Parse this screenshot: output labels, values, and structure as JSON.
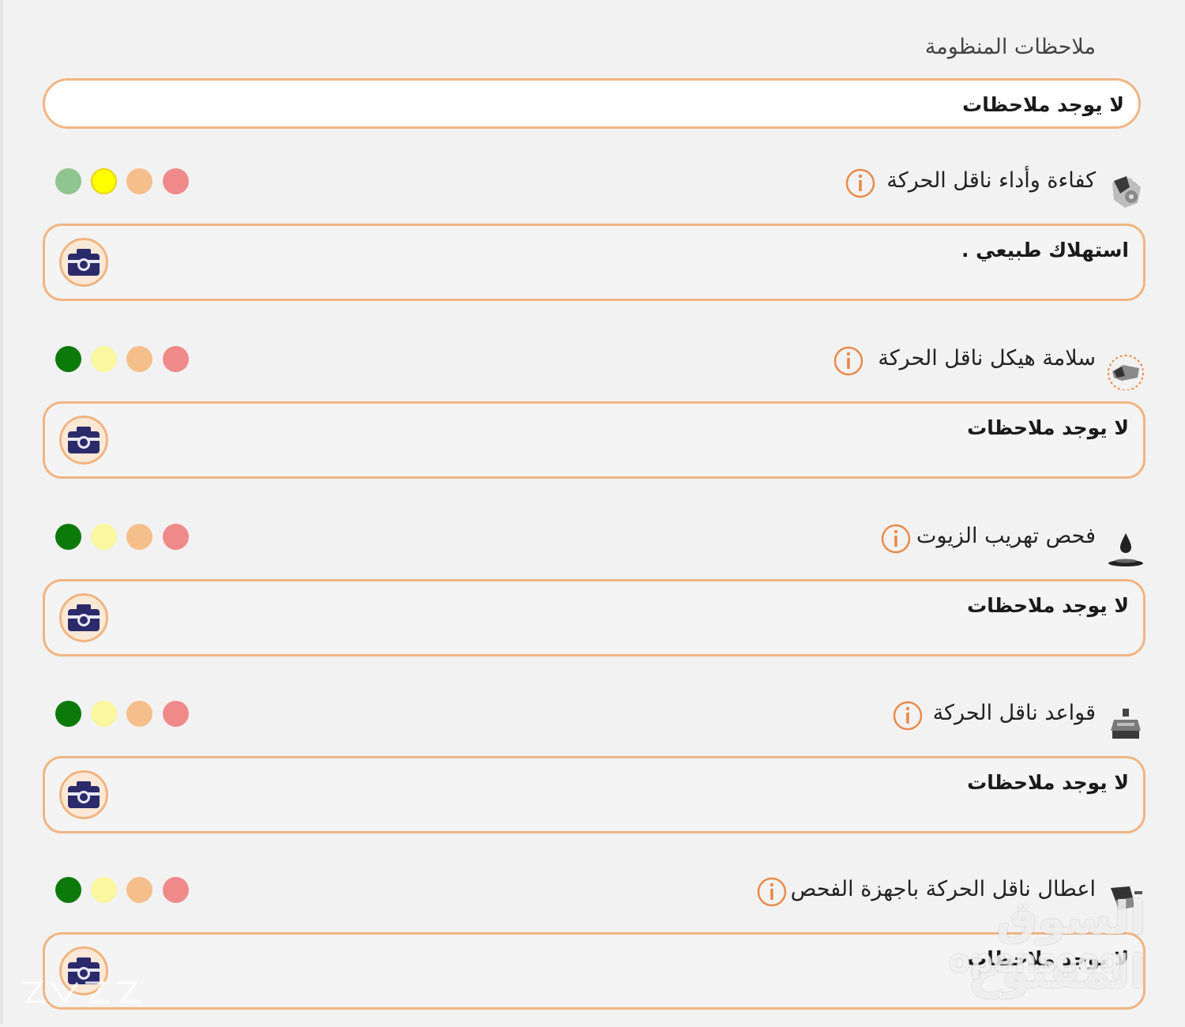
{
  "system_notes": {
    "label": "ملاحظات المنظومة",
    "value": "لا يوجد ملاحظات"
  },
  "rating_colors": [
    "#90c490",
    "#ffff00",
    "#f5bf8c",
    "#f08a8a"
  ],
  "sections": [
    {
      "title": "كفاءة وأداء ناقل الحركة",
      "icon": "transmission-gear-icon",
      "note": "استهلاك طبيعي .",
      "selected_rating": "yellow",
      "dot_colors": [
        "#90c490",
        "#ffff00",
        "#f5bf8c",
        "#f08a8a"
      ]
    },
    {
      "title": "سلامة هيكل ناقل الحركة",
      "icon": "transmission-housing-icon",
      "note": "لا يوجد ملاحظات",
      "selected_rating": "green",
      "dot_colors": [
        "#0b7a0b",
        "#fbf7a0",
        "#f5bf8c",
        "#f08a8a"
      ]
    },
    {
      "title": "فحص تهريب الزيوت",
      "icon": "oil-drop-icon",
      "note": "لا يوجد ملاحظات",
      "selected_rating": "green",
      "dot_colors": [
        "#0b7a0b",
        "#fbf7a0",
        "#f5bf8c",
        "#f08a8a"
      ]
    },
    {
      "title": "قواعد ناقل الحركة",
      "icon": "transmission-mount-icon",
      "note": "لا يوجد ملاحظات",
      "selected_rating": "green",
      "dot_colors": [
        "#0b7a0b",
        "#fbf7a0",
        "#f5bf8c",
        "#f08a8a"
      ]
    },
    {
      "title": "اعطال ناقل الحركة باجهزة الفحص",
      "icon": "diagnostic-scanner-icon",
      "note": "لا يوجد ملاحظات",
      "selected_rating": "green",
      "dot_colors": [
        "#0b7a0b",
        "#fbf7a0",
        "#f5bf8c",
        "#f08a8a"
      ]
    }
  ],
  "watermark": {
    "arabic": "السوق المفتوح",
    "latin": "opensooq"
  },
  "accent_color": "#e88a4a"
}
